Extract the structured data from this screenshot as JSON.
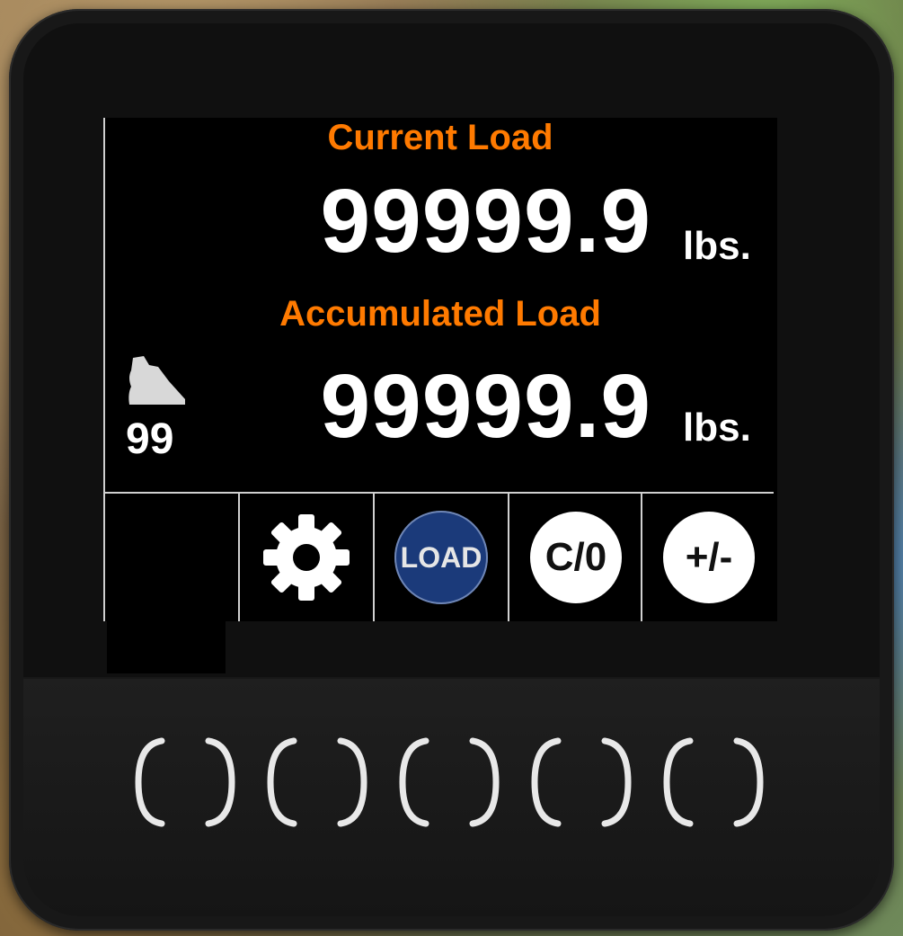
{
  "display": {
    "current_label": "Current Load",
    "current_value": "99999.9",
    "current_unit": "lbs.",
    "accumulated_label": "Accumulated Load",
    "accumulated_value": "99999.9",
    "accumulated_unit": "lbs.",
    "bucket_count": "99"
  },
  "softkeys": {
    "settings_icon": "gear-icon",
    "load_label": "LOAD",
    "clear_label": "C/0",
    "sign_label": "+/-"
  },
  "colors": {
    "label_orange": "#ff7a00",
    "load_blue": "#1b3a7a",
    "screen_bg": "#000000"
  }
}
